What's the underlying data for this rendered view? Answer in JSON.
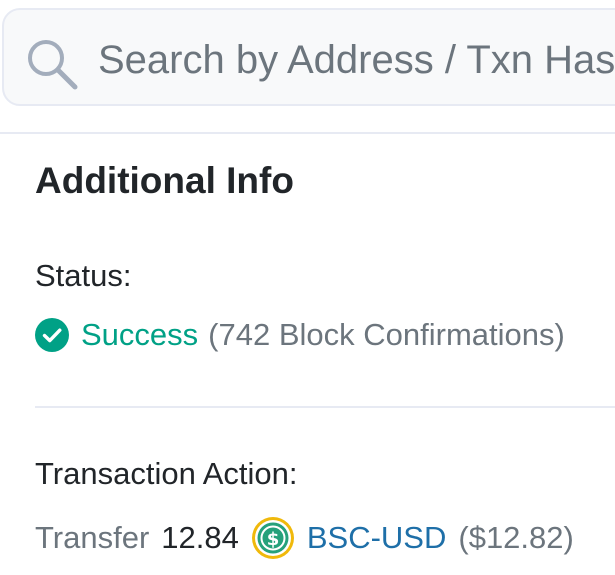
{
  "search": {
    "placeholder": "Search by Address / Txn Hash / Block / Token / Domain Name"
  },
  "additional_info": {
    "title": "Additional Info",
    "status_label": "Status:",
    "status_value": "Success",
    "confirmations": "(742 Block Confirmations)",
    "action_label": "Transaction Action:",
    "action": {
      "verb": "Transfer",
      "amount": "12.84",
      "token": "BSC-USD",
      "usd_value": "($12.82)"
    }
  },
  "colors": {
    "success": "#00a186",
    "link": "#1e6fa8",
    "muted": "#6c757d",
    "token_green": "#26a17b",
    "token_ring": "#f0b90b"
  },
  "icons": {
    "search": "search-icon",
    "status": "check-circle-icon",
    "token": "bsc-usd-token-icon"
  }
}
